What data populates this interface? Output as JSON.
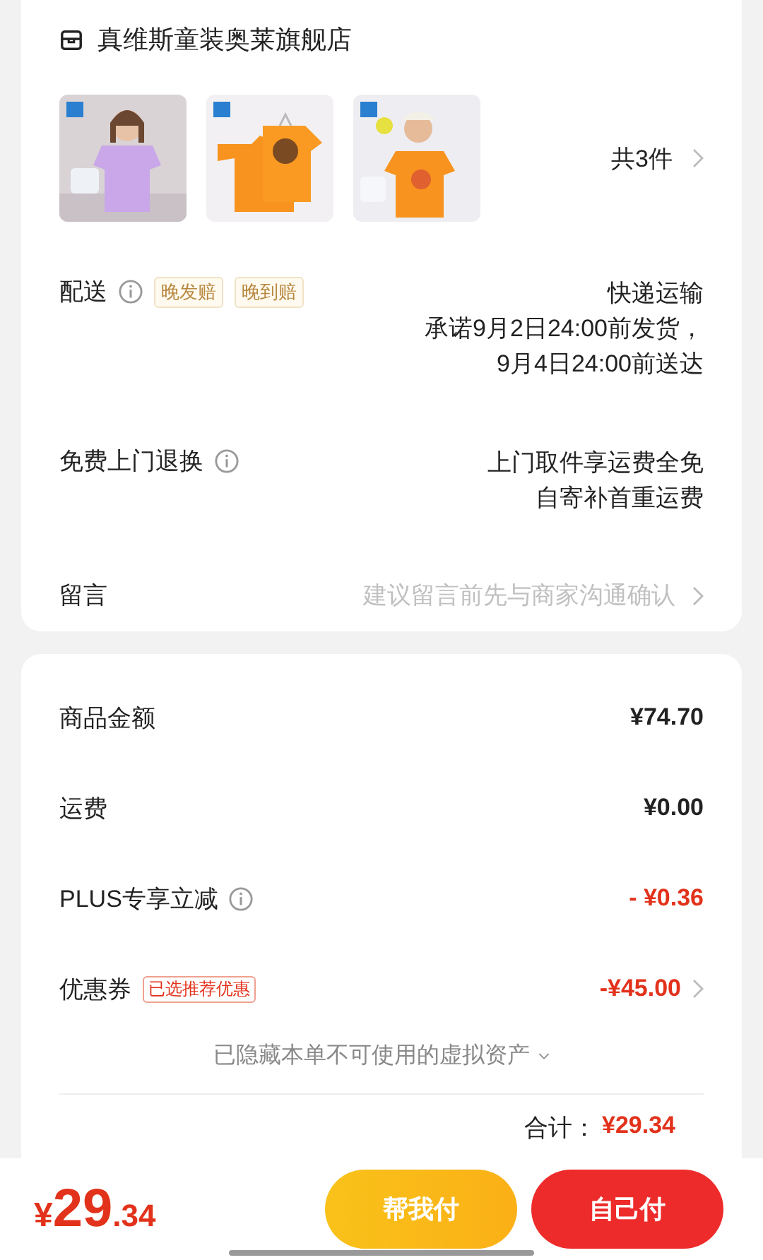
{
  "store": {
    "name": "真维斯童装奥莱旗舰店"
  },
  "products": {
    "count": "共3件"
  },
  "delivery": {
    "label": "配送",
    "tags": [
      "晚发赔",
      "晚到赔"
    ],
    "method": "快递运输",
    "lines": [
      "承诺9月2日24:00前发货，",
      "9月4日24:00前送达"
    ]
  },
  "returns": {
    "label": "免费上门退换",
    "lines": [
      "上门取件享运费全免",
      "自寄补首重运费"
    ]
  },
  "message": {
    "label": "留言",
    "placeholder": "建议留言前先与商家沟通确认"
  },
  "summary": [
    {
      "label": "商品金额",
      "value": "¥74.70",
      "kind": "plain",
      "info": false,
      "link": false
    },
    {
      "label": "运费",
      "value": "¥0.00",
      "kind": "plain",
      "info": false,
      "link": false
    },
    {
      "label": "PLUS专享立减",
      "value": "- ¥0.36",
      "kind": "discount",
      "info": true,
      "link": false
    },
    {
      "label": "优惠券",
      "tag": "已选推荐优惠",
      "value": "-¥45.00",
      "kind": "discount",
      "info": false,
      "link": true
    }
  ],
  "hidden_assets": "已隐藏本单不可使用的虚拟资产",
  "total": {
    "label": "合计：",
    "value": "¥29.34"
  },
  "pay_bar": {
    "currency": "¥",
    "amount_int": "29",
    "amount_dec": ".34",
    "buttons": [
      {
        "label": "帮我付",
        "kind": "secondary"
      },
      {
        "label": "自己付",
        "kind": "primary"
      }
    ]
  }
}
